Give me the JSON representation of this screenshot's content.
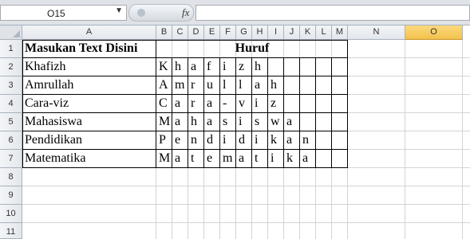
{
  "namebox": {
    "value": "O15"
  },
  "formula_bar": {
    "fx_label": "fx",
    "value": ""
  },
  "columns": [
    "A",
    "B",
    "C",
    "D",
    "E",
    "F",
    "G",
    "H",
    "I",
    "J",
    "K",
    "L",
    "M",
    "N",
    "O"
  ],
  "selected_column": "O",
  "rows": [
    "1",
    "2",
    "3",
    "4",
    "5",
    "6",
    "7",
    "8",
    "9",
    "10",
    "11"
  ],
  "sheet": {
    "header_input": "Masukan Text Disini",
    "header_letters": "Huruf",
    "words": [
      {
        "text": "Khafizh",
        "letters": [
          "K",
          "h",
          "a",
          "f",
          "i",
          "z",
          "h",
          "",
          "",
          "",
          "",
          ""
        ]
      },
      {
        "text": "Amrullah",
        "letters": [
          "A",
          "m",
          "r",
          "u",
          "l",
          "l",
          "a",
          "h",
          "",
          "",
          "",
          ""
        ]
      },
      {
        "text": "Cara-viz",
        "letters": [
          "C",
          "a",
          "r",
          "a",
          "-",
          "v",
          "i",
          "z",
          "",
          "",
          "",
          ""
        ]
      },
      {
        "text": "Mahasiswa",
        "letters": [
          "M",
          "a",
          "h",
          "a",
          "s",
          "i",
          "s",
          "w",
          "a",
          "",
          "",
          ""
        ]
      },
      {
        "text": "Pendidikan",
        "letters": [
          "P",
          "e",
          "n",
          "d",
          "i",
          "d",
          "i",
          "k",
          "a",
          "n",
          "",
          ""
        ]
      },
      {
        "text": "Matematika",
        "letters": [
          "M",
          "a",
          "t",
          "e",
          "m",
          "a",
          "t",
          "i",
          "k",
          "a",
          "",
          ""
        ]
      }
    ]
  }
}
